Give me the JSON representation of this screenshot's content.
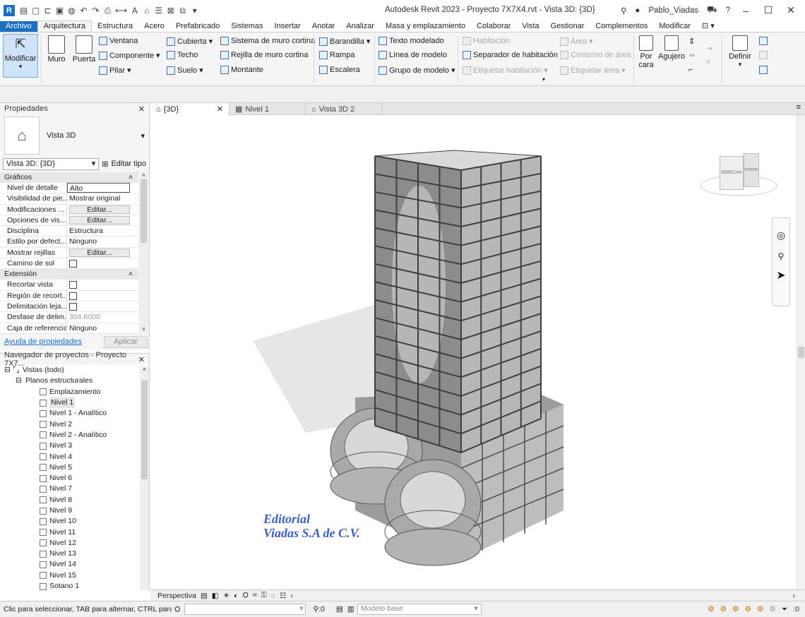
{
  "app": {
    "title": "Autodesk Revit 2023 - Proyecto 7X7X4.rvt - Vista 3D: {3D}",
    "user": "Pablo_Viadas",
    "logo_letter": "R"
  },
  "menu": [
    "Archivo",
    "Arquitectura",
    "Estructura",
    "Acero",
    "Prefabricado",
    "Sistemas",
    "Insertar",
    "Anotar",
    "Analizar",
    "Masa y emplazamiento",
    "Colaborar",
    "Vista",
    "Gestionar",
    "Complementos",
    "Modificar"
  ],
  "ribbon": {
    "modificar": "Modificar",
    "muro": "Muro",
    "puerta": "Puerta",
    "ventana": "Ventana",
    "componente": "Componente",
    "pilar": "Pilar",
    "cubierta": "Cubierta",
    "techo": "Techo",
    "suelo": "Suelo",
    "sistema_muro_cortina": "Sistema de muro cortina",
    "rejilla_muro_cortina": "Rejilla de muro cortina",
    "montante": "Montante",
    "barandilla": "Barandilla",
    "rampa": "Rampa",
    "escalera": "Escalera",
    "texto_modelado": "Texto modelado",
    "linea_modelo": "Línea de modelo",
    "grupo_modelo": "Grupo de modelo",
    "habitacion": "Habitación",
    "separador_habitacion": "Separador de habitación",
    "etiquetar_habitacion": "Etiquetar habitación",
    "area": "Área",
    "contorno_area": "Contorno de área",
    "etiquetar_area": "Etiquetar área",
    "por_cara_1": "Por",
    "por_cara_2": "cara",
    "agujero": "Agujero",
    "definir": "Definir"
  },
  "properties": {
    "header": "Propiedades",
    "type_name": "Vista 3D",
    "selector": "Vista 3D: {3D}",
    "edit_type": "Editar tipo",
    "graficos": "Gráficos",
    "extension": "Extensión",
    "rows_graphics": [
      {
        "name": "Nivel de detalle",
        "value": "Alto",
        "kind": "text"
      },
      {
        "name": "Visibilidad de pie...",
        "value": "Mostrar original",
        "kind": "text"
      },
      {
        "name": "Modificaciones ...",
        "value": "Editar...",
        "kind": "button"
      },
      {
        "name": "Opciones de vis...",
        "value": "Editar...",
        "kind": "button"
      },
      {
        "name": "Disciplina",
        "value": "Estructura",
        "kind": "text"
      },
      {
        "name": "Estilo por defect...",
        "value": "Ninguno",
        "kind": "text"
      },
      {
        "name": "Mostrar rejillas",
        "value": "Editar...",
        "kind": "button"
      },
      {
        "name": "Camino de sol",
        "value": "",
        "kind": "check"
      }
    ],
    "rows_extension": [
      {
        "name": "Recortar vista",
        "value": "",
        "kind": "check"
      },
      {
        "name": "Región de recort...",
        "value": "",
        "kind": "check"
      },
      {
        "name": "Delimitación leja...",
        "value": "",
        "kind": "check"
      },
      {
        "name": "Desfase de delim...",
        "value": "304.8000",
        "kind": "text"
      },
      {
        "name": "Caja de referencia",
        "value": "Ninguno",
        "kind": "text"
      }
    ],
    "help_link": "Ayuda de propiedades",
    "apply": "Aplicar"
  },
  "browser": {
    "header": "Navegador de proyectos - Proyecto 7X7...",
    "root": "Vistas (todo)",
    "group": "Planos estructurales",
    "items": [
      "Emplazamiento",
      "Nivel 1",
      "Nivel 1 - Analítico",
      "Nivel 2",
      "Nivel 2 - Analítico",
      "Nivel 3",
      "Nivel 4",
      "Nivel 5",
      "Nivel 6",
      "Nivel 7",
      "Nivel 8",
      "Nivel 9",
      "Nivel 10",
      "Nivel 11",
      "Nivel 12",
      "Nivel 13",
      "Nivel 14",
      "Nivel 15",
      "Sotano 1"
    ]
  },
  "tabs": [
    {
      "label": "{3D}",
      "active": true
    },
    {
      "label": "Nivel 1",
      "active": false
    },
    {
      "label": "Vista 3D 2",
      "active": false
    }
  ],
  "viewcube": {
    "left": "DERECHA",
    "right": "POSTERIOR"
  },
  "watermark": {
    "line1": "Editorial",
    "line2": "Viadas S.A de C.V."
  },
  "view_control": {
    "mode": "Perspectiva"
  },
  "status": {
    "hint": "Clic para seleccionar, TAB para alternar, CTRL para añ",
    "count": ":0",
    "model": "Modelo base",
    "filter_count": ":0"
  },
  "colors": {
    "accent": "#1b6ec2",
    "building_face": "#c4c4c4",
    "building_dark": "#6f6f6f"
  }
}
